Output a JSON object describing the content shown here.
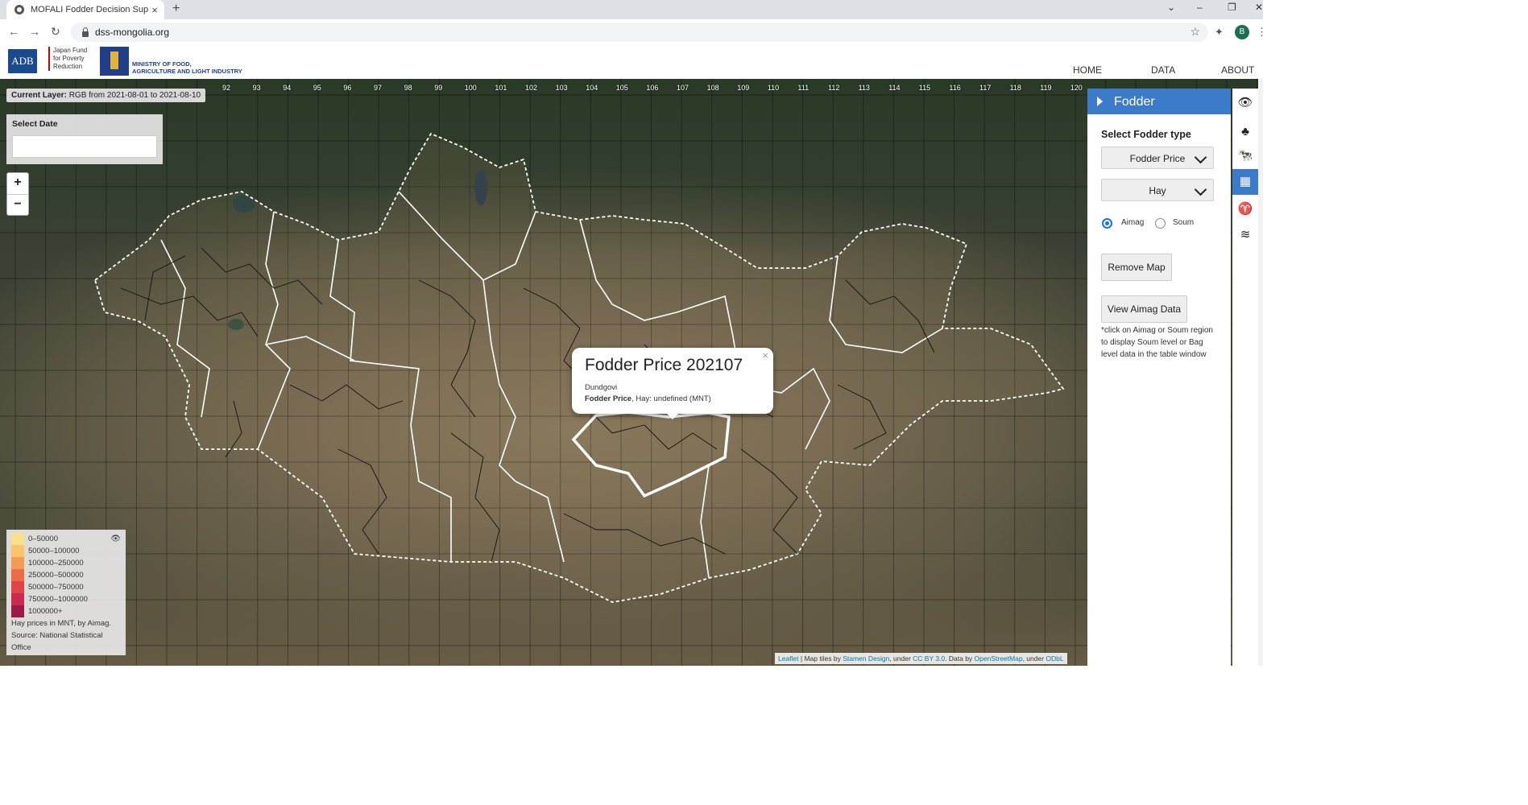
{
  "browser": {
    "tab_title": "MOFALI Fodder Decision Suppor",
    "tab_close": "×",
    "new_tab": "+",
    "url": "dss-mongolia.org",
    "profile_initial": "B"
  },
  "header": {
    "adb_logo": "ADB",
    "jfpr_text": "Japan Fund for Poverty Reduction",
    "ministry_line1": "MINISTRY OF FOOD,",
    "ministry_line2": "AGRICULTURE AND LIGHT INDUSTRY",
    "nav": [
      {
        "label": "HOME"
      },
      {
        "label": "DATA"
      },
      {
        "label": "ABOUT"
      }
    ]
  },
  "map": {
    "current_layer_label": "Current Layer:",
    "current_layer_value": "RGB from 2021-08-01 to 2021-08-10",
    "select_date_label": "Select Date",
    "select_date_value": "",
    "zoom_in": "+",
    "zoom_out": "−",
    "longitude_labels": [
      "92",
      "93",
      "94",
      "95",
      "96",
      "97",
      "98",
      "99",
      "100",
      "101",
      "102",
      "103",
      "104",
      "105",
      "106",
      "107",
      "108",
      "109",
      "110",
      "111",
      "112",
      "113",
      "114",
      "115",
      "116",
      "117",
      "118",
      "119",
      "120"
    ],
    "popup": {
      "title": "Fodder Price 202107",
      "region": "Dundgovi",
      "metric": "Fodder Price",
      "detail": ", Hay: undefined (MNT)",
      "close": "×"
    },
    "legend": {
      "items": [
        {
          "label": "0–50000",
          "color": "#fbe08a"
        },
        {
          "label": "50000–100000",
          "color": "#f9c46a"
        },
        {
          "label": "100000–250000",
          "color": "#f59b53"
        },
        {
          "label": "250000–500000",
          "color": "#ee6b47"
        },
        {
          "label": "500000–750000",
          "color": "#e0434a"
        },
        {
          "label": "750000–1000000",
          "color": "#c92a4d"
        },
        {
          "label": "1000000+",
          "color": "#9d1a48"
        }
      ],
      "note": "Hay prices in MNT, by Aimag. Source: National Statistical Office"
    },
    "attribution": {
      "leaflet": "Leaflet",
      "t1": " | Map tiles by ",
      "stamen": "Stamen Design",
      "t2": ", under ",
      "ccby": "CC BY 3.0",
      "t3": ". Data by ",
      "osm": "OpenStreetMap",
      "t4": ", under ",
      "odbl": "ODbL"
    }
  },
  "panel": {
    "title": "Fodder",
    "select_label": "Select Fodder type",
    "fodder_type": "Fodder Price",
    "fodder_item": "Hay",
    "radio_aimag": "Aimag",
    "radio_soum": "Soum",
    "selected_level": "Aimag",
    "remove_button": "Remove Map",
    "view_button": "View Aimag Data",
    "hint": "*click on Aimag or Soum region to display Soum level or Bag level data in the table window"
  },
  "colors": {
    "accent": "#3c7bc9",
    "popup_highlight": "#ffffff"
  }
}
